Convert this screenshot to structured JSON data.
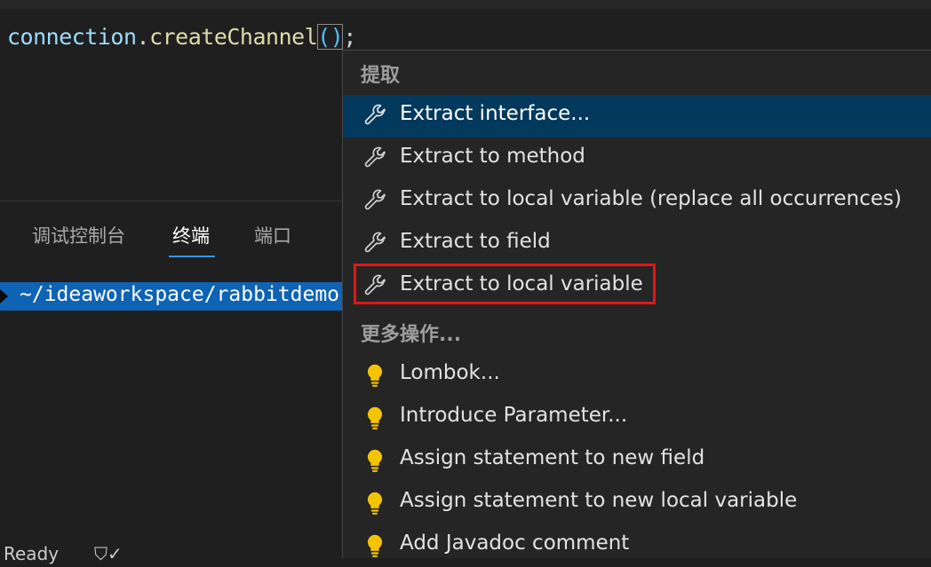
{
  "editor": {
    "code": {
      "object": "connection",
      "dot": ".",
      "method": "createChannel",
      "parens": "()",
      "semicolon": ";"
    }
  },
  "panel": {
    "tabs": [
      {
        "label": "调试控制台",
        "active": false
      },
      {
        "label": "终端",
        "active": true
      },
      {
        "label": "端口",
        "active": false
      }
    ]
  },
  "terminal": {
    "path": "~/ideaworkspace/rabbitdemo"
  },
  "status": {
    "ready": "Ready",
    "shield": "⛉✓"
  },
  "menu": {
    "extract_header": "提取",
    "extract_items": [
      {
        "label": "Extract interface...",
        "icon": "wrench-icon",
        "selected": true
      },
      {
        "label": "Extract to method",
        "icon": "wrench-icon",
        "selected": false
      },
      {
        "label": "Extract to local variable (replace all occurrences)",
        "icon": "wrench-icon",
        "selected": false
      },
      {
        "label": "Extract to field",
        "icon": "wrench-icon",
        "selected": false
      },
      {
        "label": "Extract to local variable",
        "icon": "wrench-icon",
        "selected": false,
        "highlighted": true
      }
    ],
    "more_header": "更多操作...",
    "more_items": [
      {
        "label": "Lombok...",
        "icon": "lightbulb-icon"
      },
      {
        "label": "Introduce Parameter...",
        "icon": "lightbulb-icon"
      },
      {
        "label": "Assign statement to new field",
        "icon": "lightbulb-icon"
      },
      {
        "label": "Assign statement to new local variable",
        "icon": "lightbulb-icon"
      },
      {
        "label": "Add Javadoc comment",
        "icon": "lightbulb-icon"
      }
    ]
  },
  "colors": {
    "selected_bg": "#04395e",
    "highlight_border": "#e51515",
    "lightbulb": "#f5c400",
    "accent": "#3794ff"
  }
}
